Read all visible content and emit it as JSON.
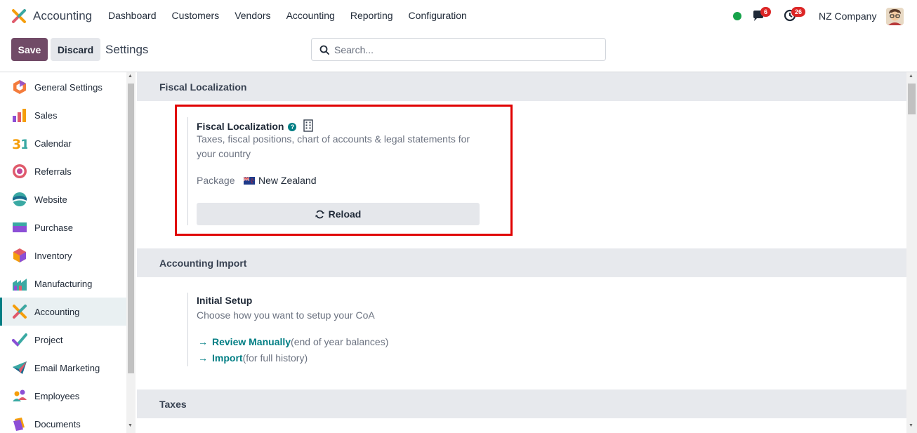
{
  "navbar": {
    "app_name": "Accounting",
    "menu": [
      "Dashboard",
      "Customers",
      "Vendors",
      "Accounting",
      "Reporting",
      "Configuration"
    ],
    "messages_count": "6",
    "activities_count": "26",
    "company": "NZ Company"
  },
  "control_panel": {
    "save_label": "Save",
    "discard_label": "Discard",
    "title": "Settings",
    "search_placeholder": "Search..."
  },
  "sidebar": {
    "items": [
      {
        "label": "General Settings",
        "icon": "general-settings-icon"
      },
      {
        "label": "Sales",
        "icon": "sales-icon"
      },
      {
        "label": "Calendar",
        "icon": "calendar-icon"
      },
      {
        "label": "Referrals",
        "icon": "referrals-icon"
      },
      {
        "label": "Website",
        "icon": "website-icon"
      },
      {
        "label": "Purchase",
        "icon": "purchase-icon"
      },
      {
        "label": "Inventory",
        "icon": "inventory-icon"
      },
      {
        "label": "Manufacturing",
        "icon": "manufacturing-icon"
      },
      {
        "label": "Accounting",
        "icon": "accounting-icon",
        "active": true
      },
      {
        "label": "Project",
        "icon": "project-icon"
      },
      {
        "label": "Email Marketing",
        "icon": "email-marketing-icon"
      },
      {
        "label": "Employees",
        "icon": "employees-icon"
      },
      {
        "label": "Documents",
        "icon": "documents-icon"
      }
    ]
  },
  "fiscal": {
    "section_title": "Fiscal Localization",
    "setting_title": "Fiscal Localization",
    "description_line1": "Taxes, fiscal positions, chart of accounts & legal statements for",
    "description_line2": "your country",
    "package_label": "Package",
    "package_value": "New Zealand",
    "reload_label": "Reload"
  },
  "import": {
    "section_title": "Accounting Import",
    "setting_title": "Initial Setup",
    "description": "Choose how you want to setup your CoA",
    "links": [
      {
        "label": "Review Manually",
        "note": "(end of year balances)"
      },
      {
        "label": "Import",
        "note": "(for full history)"
      }
    ]
  },
  "taxes": {
    "section_title": "Taxes"
  },
  "colors": {
    "brand": "#714b67",
    "accent": "#017e84",
    "highlight": "#e00000"
  }
}
